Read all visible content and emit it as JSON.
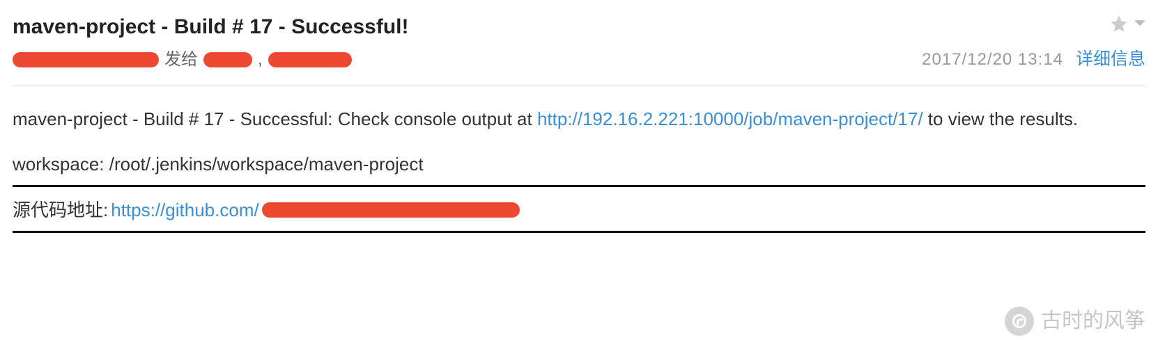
{
  "email": {
    "subject": "maven-project - Build # 17 - Successful!",
    "sender_label": "发给",
    "comma": ",",
    "timestamp": "2017/12/20  13:14",
    "detail_link": "详细信息"
  },
  "body": {
    "para1_prefix": "maven-project - Build # 17 - Successful: Check console output at ",
    "para1_link": "http://192.16.2.221:10000/job/maven-project/17/",
    "para1_suffix": " to view the results.",
    "workspace": "workspace: /root/.jenkins/workspace/maven-project",
    "source_label": "源代码地址: ",
    "source_link_visible": "https://github.com/"
  },
  "watermark": {
    "text": "古时的风筝"
  }
}
